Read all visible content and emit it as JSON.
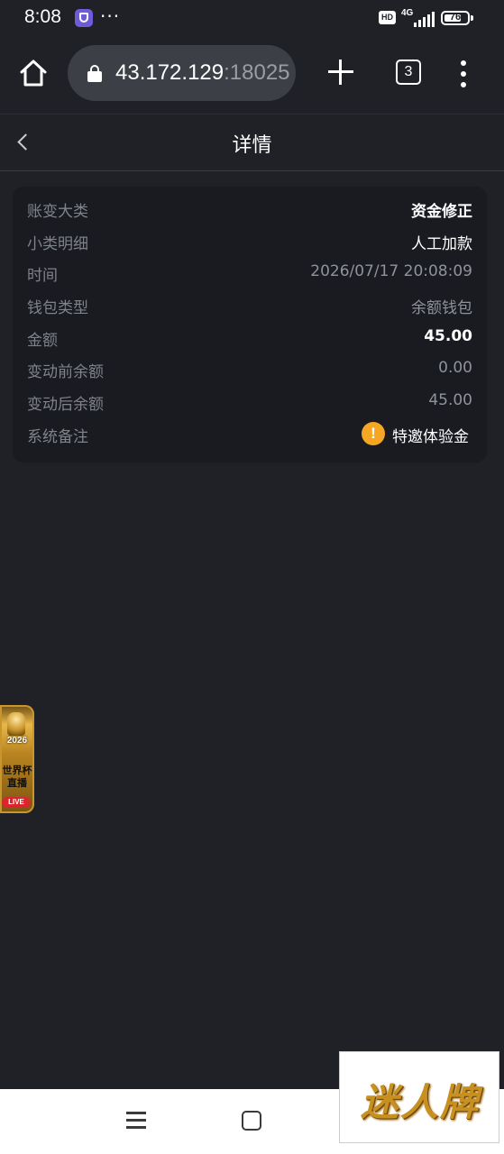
{
  "status_bar": {
    "time": "8:08",
    "more": "···",
    "hd": "HD",
    "network": "4G",
    "battery": "76",
    "battery_level": 0.76
  },
  "browser": {
    "url_host": "43.172.129",
    "url_port": ":18025",
    "tab_count": "3"
  },
  "page": {
    "title": "详情"
  },
  "detail": {
    "rows": [
      {
        "label": "账变大类",
        "value": "资金修正"
      },
      {
        "label": "小类明细",
        "value": "人工加款"
      },
      {
        "label": "时间",
        "value": "2026/07/17 20:08:09"
      },
      {
        "label": "钱包类型",
        "value": "余额钱包"
      },
      {
        "label": "金额",
        "value": "45.00"
      },
      {
        "label": "变动前余额",
        "value": "0.00"
      },
      {
        "label": "变动后余额",
        "value": "45.00"
      },
      {
        "label": "系统备注",
        "value": "特邀体验金"
      }
    ],
    "remark_icon": "!"
  },
  "floating_badge": {
    "year": "2026",
    "text_line1": "世界杯",
    "text_line2": "直播",
    "live": "LIVE"
  },
  "watermark": {
    "text": "迷人牌"
  },
  "colors": {
    "background": "#1f2127",
    "card": "#191b20",
    "accent_warning": "#f5a623"
  }
}
